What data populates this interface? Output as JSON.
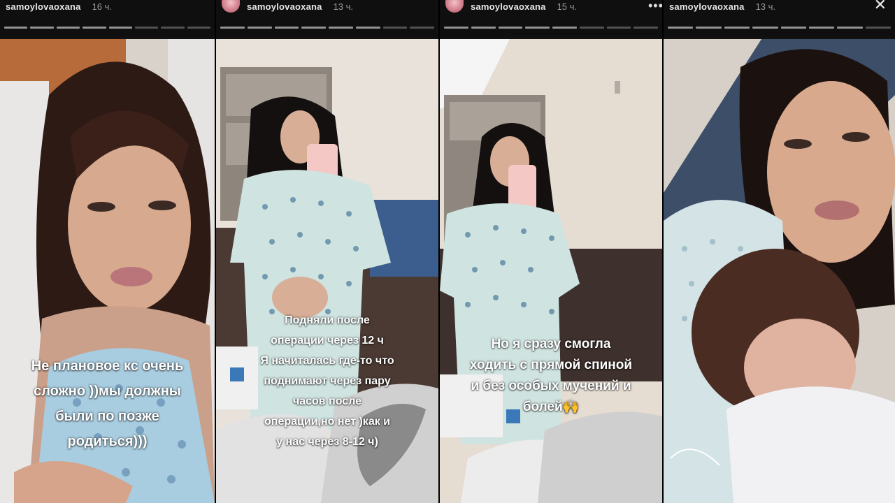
{
  "stories": [
    {
      "username": "samoylovaoxana",
      "time": "16 ч.",
      "caption_lines": [
        "Не плановое кс очень",
        "сложно ))мы должны",
        "были по позже",
        "родиться)))"
      ]
    },
    {
      "username": "samoylovaoxana",
      "time": "13 ч.",
      "caption_lines": [
        "Подняли после",
        "операции через 12 ч",
        "Я начиталась где-то что",
        "поднимают через пару",
        "часов после",
        "операции,но нет )как и",
        "у нас через 8-12 ч)"
      ]
    },
    {
      "username": "samoylovaoxana",
      "time": "15 ч.",
      "caption_lines": [
        "Но я сразу смогла",
        "ходить с прямой спиной",
        "и без особых мучений и",
        "болей🙌"
      ]
    },
    {
      "username": "samoylovaoxana",
      "time": "13 ч.",
      "caption_lines": []
    }
  ],
  "icons": {
    "more": "more-icon",
    "close": "close-icon"
  },
  "colors": {
    "bar_bg": "#0f0f10",
    "caption": "#ffffff",
    "gown": "#cfe3e0"
  }
}
